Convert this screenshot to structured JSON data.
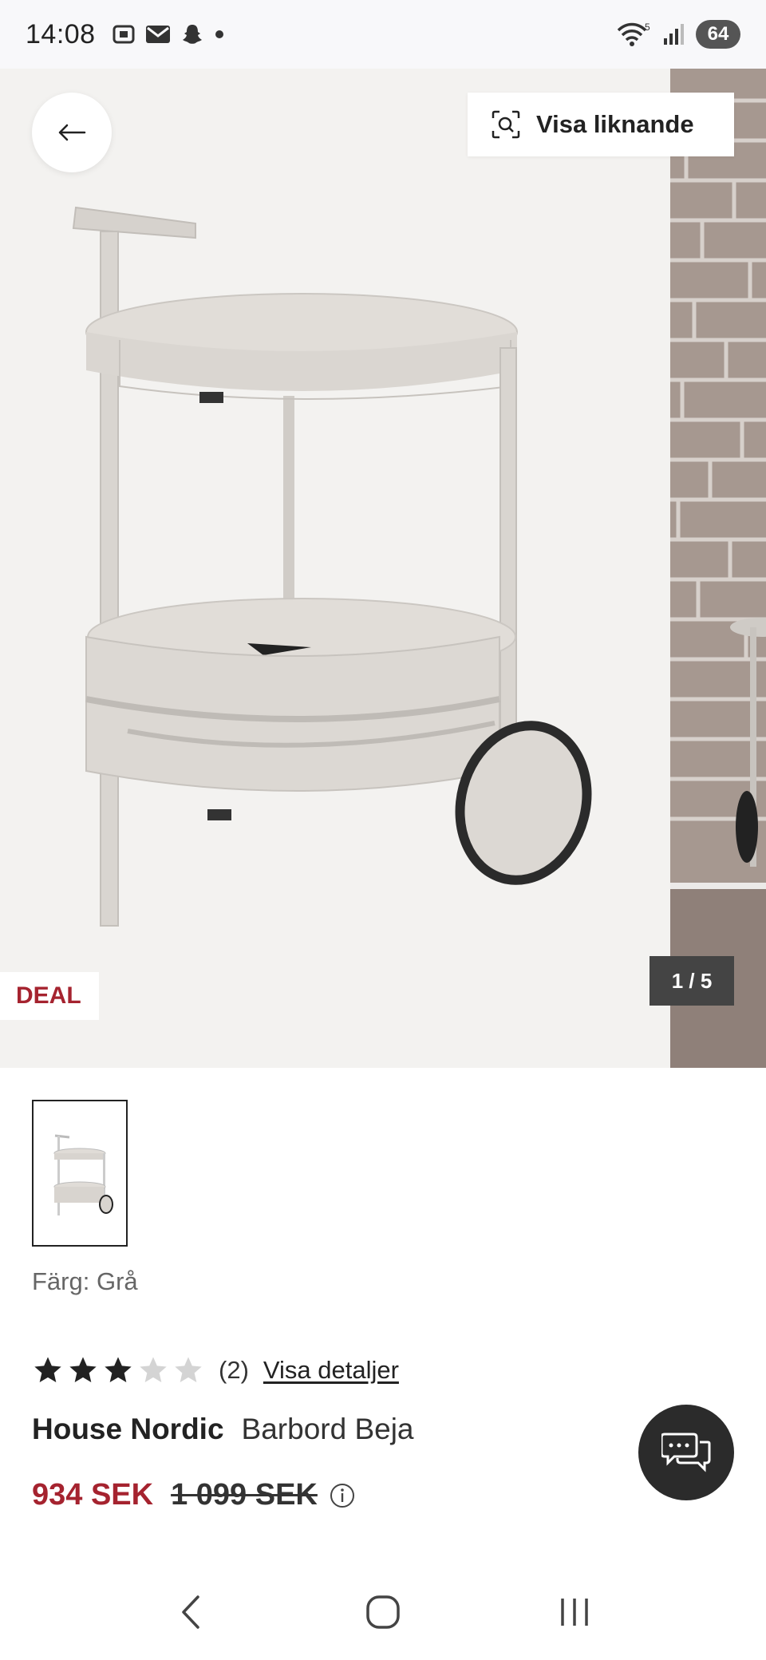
{
  "status_bar": {
    "time": "14:08",
    "wifi_badge": "5",
    "battery": "64",
    "left_icons": [
      "screenshot-icon",
      "mail-icon",
      "snapchat-icon",
      "dot-icon"
    ],
    "right_icons": [
      "wifi-icon",
      "signal-icon",
      "battery-icon"
    ]
  },
  "gallery": {
    "similar_label": "Visa liknande",
    "deal_label": "DEAL",
    "counter": "1 / 5",
    "current_index": 1,
    "total_images": 5
  },
  "product": {
    "color_line": "Färg: Grå",
    "rating": 3,
    "rating_max": 5,
    "review_count": "(2)",
    "details_link": "Visa detaljer",
    "brand": "House Nordic",
    "name": "Barbord Beja",
    "price_now": "934 SEK",
    "price_old": "1 099 SEK"
  },
  "colors": {
    "accent_red": "#a5232f",
    "dark": "#2b2b2b",
    "product_grey": "#d8d4cf"
  },
  "nav": {
    "icons": [
      "back-nav-icon",
      "home-nav-icon",
      "recents-nav-icon"
    ]
  }
}
